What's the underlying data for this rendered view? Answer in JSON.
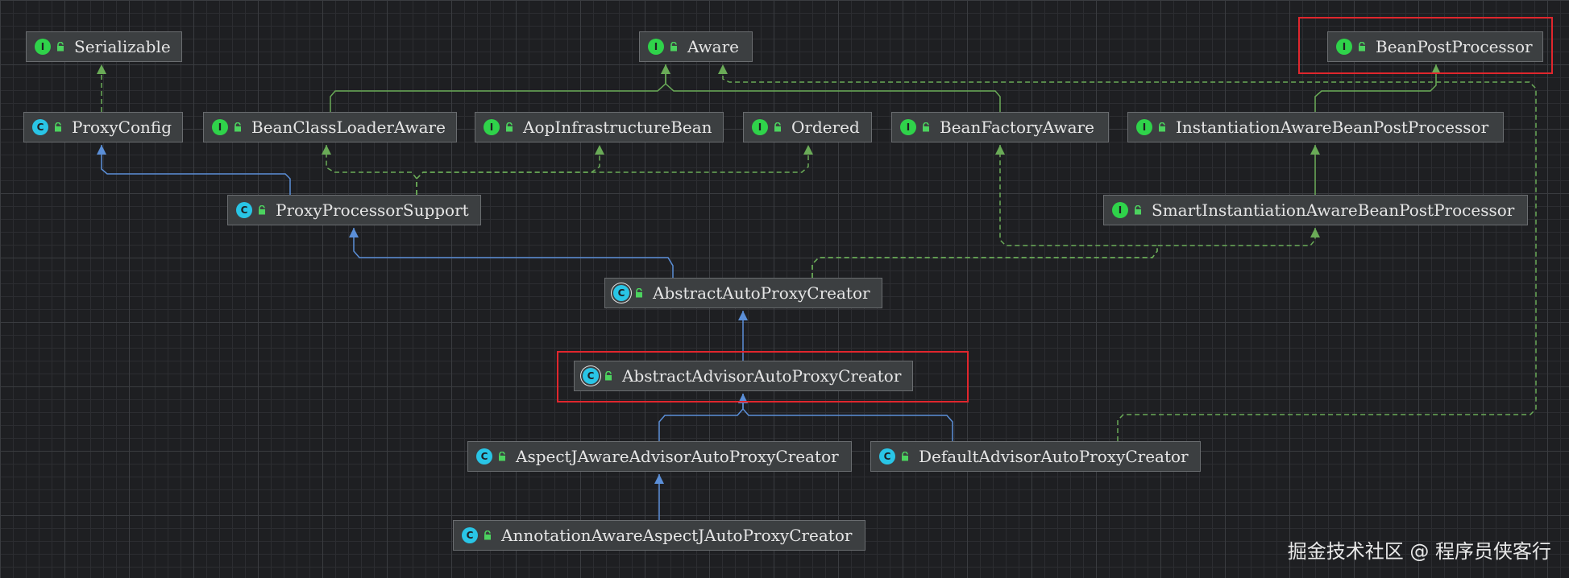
{
  "colors": {
    "background": "#1e1f22",
    "node_bg": "#3c3f41",
    "interface_badge": "#2fd34a",
    "class_badge": "#29c5e6",
    "extends_edge": "#5b8fd8",
    "implements_edge": "#6aab57",
    "highlight": "#e0262d"
  },
  "nodes": [
    {
      "id": "Serializable",
      "label": "Serializable",
      "kind": "interface",
      "icon": "interface-icon"
    },
    {
      "id": "Aware",
      "label": "Aware",
      "kind": "interface",
      "icon": "interface-icon"
    },
    {
      "id": "BeanPostProcessor",
      "label": "BeanPostProcessor",
      "kind": "interface",
      "icon": "interface-icon"
    },
    {
      "id": "ProxyConfig",
      "label": "ProxyConfig",
      "kind": "class",
      "icon": "class-icon"
    },
    {
      "id": "BeanClassLoaderAware",
      "label": "BeanClassLoaderAware",
      "kind": "interface",
      "icon": "interface-icon"
    },
    {
      "id": "AopInfrastructureBean",
      "label": "AopInfrastructureBean",
      "kind": "interface",
      "icon": "interface-icon"
    },
    {
      "id": "Ordered",
      "label": "Ordered",
      "kind": "interface",
      "icon": "interface-icon"
    },
    {
      "id": "BeanFactoryAware",
      "label": "BeanFactoryAware",
      "kind": "interface",
      "icon": "interface-icon"
    },
    {
      "id": "InstantiationAwareBeanPostProcessor",
      "label": "InstantiationAwareBeanPostProcessor",
      "kind": "interface",
      "icon": "interface-icon"
    },
    {
      "id": "ProxyProcessorSupport",
      "label": "ProxyProcessorSupport",
      "kind": "class",
      "icon": "class-icon"
    },
    {
      "id": "SmartInstantiationAwareBeanPostProcessor",
      "label": "SmartInstantiationAwareBeanPostProcessor",
      "kind": "interface",
      "icon": "interface-icon"
    },
    {
      "id": "AbstractAutoProxyCreator",
      "label": "AbstractAutoProxyCreator",
      "kind": "abstract",
      "icon": "abstract-class-icon"
    },
    {
      "id": "AbstractAdvisorAutoProxyCreator",
      "label": "AbstractAdvisorAutoProxyCreator",
      "kind": "abstract",
      "icon": "abstract-class-icon"
    },
    {
      "id": "AspectJAwareAdvisorAutoProxyCreator",
      "label": "AspectJAwareAdvisorAutoProxyCreator",
      "kind": "class",
      "icon": "class-icon"
    },
    {
      "id": "DefaultAdvisorAutoProxyCreator",
      "label": "DefaultAdvisorAutoProxyCreator",
      "kind": "class",
      "icon": "class-icon"
    },
    {
      "id": "AnnotationAwareAspectJAutoProxyCreator",
      "label": "AnnotationAwareAspectJAutoProxyCreator",
      "kind": "class",
      "icon": "class-icon"
    }
  ],
  "edges": [
    {
      "from": "ProxyConfig",
      "to": "Serializable",
      "type": "implements"
    },
    {
      "from": "BeanClassLoaderAware",
      "to": "Aware",
      "type": "extends"
    },
    {
      "from": "BeanFactoryAware",
      "to": "Aware",
      "type": "extends"
    },
    {
      "from": "InstantiationAwareBeanPostProcessor",
      "to": "BeanPostProcessor",
      "type": "extends"
    },
    {
      "from": "SmartInstantiationAwareBeanPostProcessor",
      "to": "InstantiationAwareBeanPostProcessor",
      "type": "extends"
    },
    {
      "from": "ProxyProcessorSupport",
      "to": "ProxyConfig",
      "type": "extends"
    },
    {
      "from": "ProxyProcessorSupport",
      "to": "BeanClassLoaderAware",
      "type": "implements"
    },
    {
      "from": "ProxyProcessorSupport",
      "to": "AopInfrastructureBean",
      "type": "implements"
    },
    {
      "from": "ProxyProcessorSupport",
      "to": "Ordered",
      "type": "implements"
    },
    {
      "from": "AbstractAutoProxyCreator",
      "to": "ProxyProcessorSupport",
      "type": "extends"
    },
    {
      "from": "AbstractAutoProxyCreator",
      "to": "BeanFactoryAware",
      "type": "implements"
    },
    {
      "from": "AbstractAutoProxyCreator",
      "to": "SmartInstantiationAwareBeanPostProcessor",
      "type": "implements"
    },
    {
      "from": "AbstractAdvisorAutoProxyCreator",
      "to": "AbstractAutoProxyCreator",
      "type": "extends"
    },
    {
      "from": "AspectJAwareAdvisorAutoProxyCreator",
      "to": "AbstractAdvisorAutoProxyCreator",
      "type": "extends"
    },
    {
      "from": "DefaultAdvisorAutoProxyCreator",
      "to": "AbstractAdvisorAutoProxyCreator",
      "type": "extends"
    },
    {
      "from": "DefaultAdvisorAutoProxyCreator",
      "to": "Aware",
      "type": "implements"
    },
    {
      "from": "AnnotationAwareAspectJAutoProxyCreator",
      "to": "AspectJAwareAdvisorAutoProxyCreator",
      "type": "extends"
    }
  ],
  "highlighted": [
    "BeanPostProcessor",
    "AbstractAdvisorAutoProxyCreator"
  ],
  "watermark": "掘金技术社区 @ 程序员侠客行"
}
